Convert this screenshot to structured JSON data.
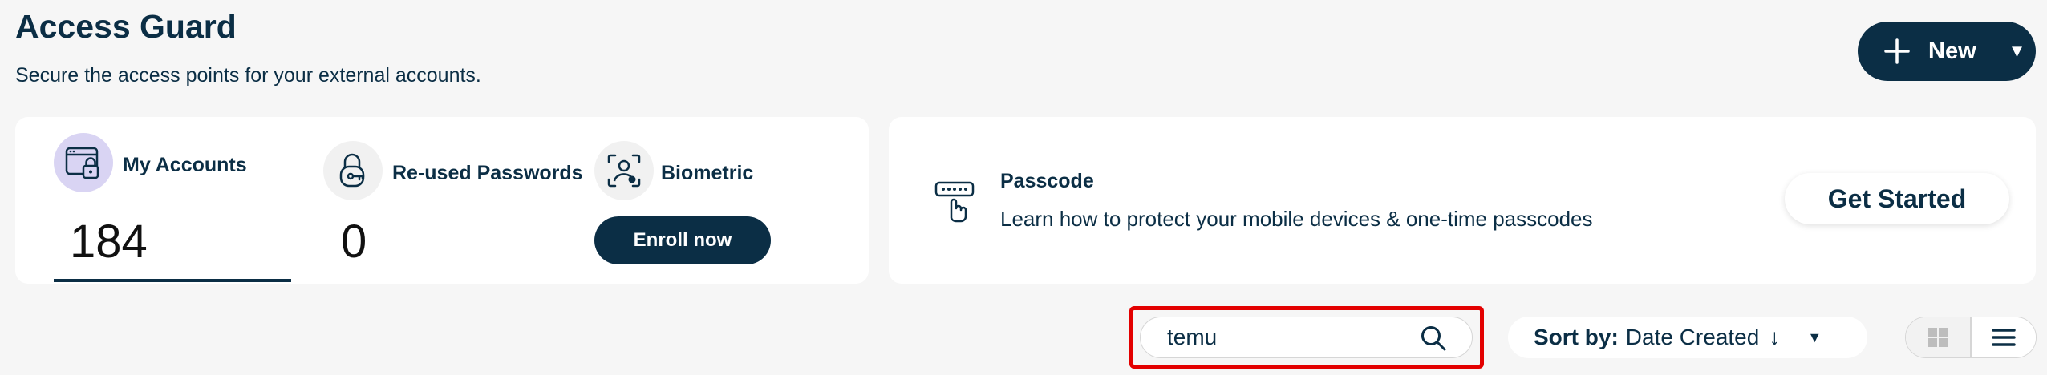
{
  "header": {
    "title": "Access Guard",
    "subtitle": "Secure the access points for your external accounts."
  },
  "new_button": {
    "label": "New",
    "icon": "plus-icon",
    "caret": "▼"
  },
  "stats": [
    {
      "label": "My Accounts",
      "value": "184",
      "icon": "browser-lock-icon",
      "active": true
    },
    {
      "label": "Re-used Passwords",
      "value": "0",
      "icon": "lock-key-icon",
      "active": false
    },
    {
      "label": "Biometric",
      "icon": "face-scan-icon",
      "action_label": "Enroll now"
    }
  ],
  "passcode": {
    "icon": "keypad-pointer-icon",
    "title": "Passcode",
    "description": "Learn how to protect your mobile devices & one-time passcodes",
    "button_label": "Get Started"
  },
  "search": {
    "value": "temu",
    "placeholder": ""
  },
  "sort": {
    "label": "Sort by:",
    "value": "Date Created",
    "direction_glyph": "↓",
    "caret": "▼"
  },
  "view_toggle": {
    "options": [
      "grid",
      "list"
    ],
    "selected": "list"
  },
  "colors": {
    "primary": "#0b2e45",
    "background": "#f6f6f6",
    "active_circle": "#d9d4f3",
    "inactive_circle": "#f1f1f1",
    "highlight": "#e30000"
  }
}
